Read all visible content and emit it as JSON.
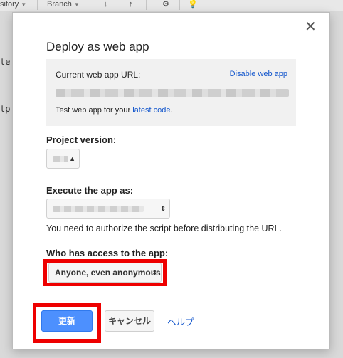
{
  "toolbar": {
    "repository_label": "sitory",
    "branch_label": "Branch"
  },
  "background_code": {
    "line1": "te",
    "line2": "tp"
  },
  "dialog": {
    "title": "Deploy as web app",
    "current_url_label": "Current web app URL:",
    "disable_link": "Disable web app",
    "test_prefix": "Test web app for your ",
    "test_link": "latest code",
    "test_suffix": ".",
    "project_version_label": "Project version:",
    "execute_label": "Execute the app as:",
    "authorize_note": "You need to authorize the script before distributing the URL.",
    "access_label": "Who has access to the app:",
    "access_value": "Anyone, even anonymous",
    "update_button": "更新",
    "cancel_button": "キャンセル",
    "help_link": "ヘルプ",
    "close_symbol": "✕"
  },
  "colors": {
    "primary_button": "#4d90fe",
    "link": "#1155cc",
    "highlight": "#ee0000"
  }
}
